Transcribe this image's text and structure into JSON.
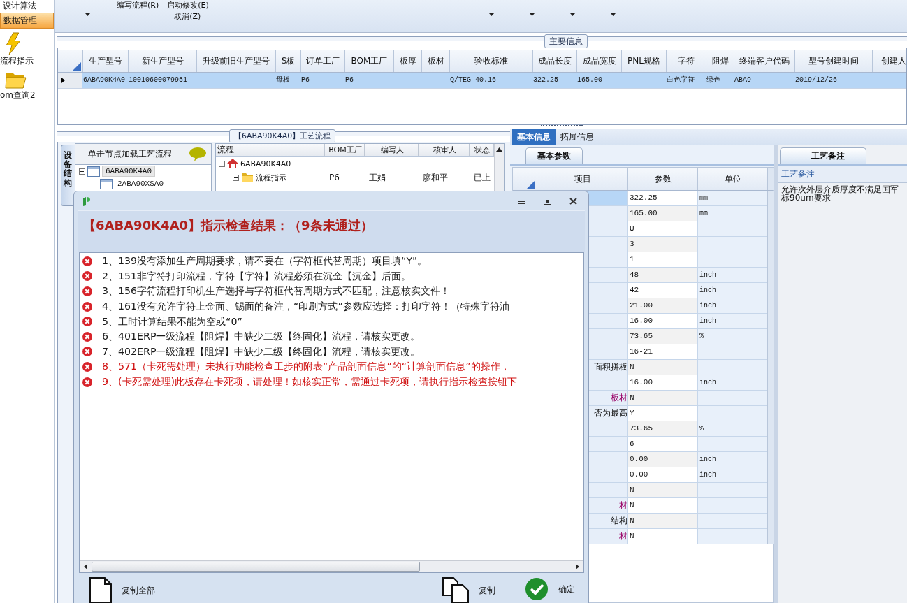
{
  "sidebar": {
    "items": [
      {
        "label": "设计算法",
        "selected": false,
        "kind": "text"
      },
      {
        "label": "数据管理",
        "selected": true,
        "kind": "text"
      },
      {
        "label": "流程指示",
        "selected": false,
        "kind": "lightning"
      },
      {
        "label": "om查询2",
        "selected": false,
        "kind": "folder"
      }
    ]
  },
  "toolbar": {
    "buttons": [
      {
        "label": "编写流程(R)"
      },
      {
        "label": "启动修改(E)"
      },
      {
        "label": "取消(Z)"
      }
    ]
  },
  "main_info": {
    "title": "主要信息",
    "columns": [
      "生产型号",
      "新生产型号",
      "升级前旧生产型号",
      "S板",
      "订单工厂",
      "BOM工厂",
      "板厚",
      "板材",
      "验收标准",
      "成品长度",
      "成品宽度",
      "PNL规格",
      "字符",
      "阻焊",
      "终端客户代码",
      "型号创建时间",
      "创建人"
    ],
    "rows": [
      {
        "selected": true,
        "cells": [
          "6ABA90K4A0",
          "10010600079951",
          null,
          "母板",
          "P6",
          "P6",
          null,
          null,
          "Q/TEG 40.16",
          "322.25",
          "165.00",
          null,
          "白色字符",
          "绿色",
          "ABA9",
          "2019/12/26",
          null
        ]
      }
    ]
  },
  "process_flow": {
    "title": "【6ABA90K4A0】工艺流程",
    "side_tab": "设备结构",
    "tree": {
      "header": "单击节点加载工艺流程",
      "nodes": [
        {
          "label": "6ABA90K4A0",
          "expanded": true,
          "selected": true,
          "children": [
            {
              "label": "2ABA90XSA0",
              "selected": false
            }
          ]
        }
      ]
    },
    "grid": {
      "columns": [
        "流程",
        "BOM工厂",
        "编写人",
        "核审人",
        "状态"
      ],
      "nodes": [
        {
          "label": "6ABA90K4A0",
          "kind": "home",
          "expanded": true,
          "children": [
            {
              "label": "流程指示",
              "kind": "folder",
              "expanded": true,
              "cells": [
                "P6",
                "王娟",
                "廖和平",
                "已上"
              ]
            }
          ]
        }
      ]
    }
  },
  "details": {
    "tabs": [
      {
        "label": "基本信息",
        "selected": true
      },
      {
        "label": "拓展信息",
        "selected": false
      }
    ],
    "param_tab": "基本参数",
    "columns": [
      "项目",
      "参数",
      "单位"
    ],
    "rows": [
      {
        "selected": true,
        "value": "322.25",
        "unit": "mm"
      },
      {
        "selected": false,
        "value": "165.00",
        "unit": "mm"
      },
      {
        "selected": false,
        "value": "U"
      },
      {
        "selected": false,
        "value": "3"
      },
      {
        "selected": false,
        "value": "1"
      },
      {
        "selected": false,
        "value": "48",
        "unit": "inch"
      },
      {
        "selected": false,
        "value": "42",
        "unit": "inch"
      },
      {
        "selected": false,
        "value": "21.00",
        "unit": "inch"
      },
      {
        "selected": false,
        "value": "16.00",
        "unit": "inch"
      },
      {
        "selected": false,
        "value": "73.65",
        "unit": "%"
      },
      {
        "selected": false,
        "value": "16-21"
      },
      {
        "selected": false,
        "item": "面积拼板",
        "value": "N"
      },
      {
        "selected": false,
        "value": "16.00",
        "unit": "inch"
      },
      {
        "selected": false,
        "item": "板材",
        "color": "#990066",
        "value": "N"
      },
      {
        "selected": false,
        "item": "否为最高",
        "value": "Y"
      },
      {
        "selected": false,
        "value": "73.65",
        "unit": "%"
      },
      {
        "selected": false,
        "value": "6"
      },
      {
        "selected": false,
        "value": "0.00",
        "unit": "inch"
      },
      {
        "selected": false,
        "value": "0.00",
        "unit": "inch"
      },
      {
        "selected": false,
        "value": "N"
      },
      {
        "selected": false,
        "item": "材",
        "color": "#990066",
        "value": "N"
      },
      {
        "selected": false,
        "item": "结构",
        "value": "N"
      },
      {
        "selected": false,
        "item": "材",
        "color": "#990066",
        "value": "N"
      }
    ],
    "notes": {
      "tab": "工艺备注",
      "header": "工艺备注",
      "text": "允许次外层介质厚度不满足国军标90um要求"
    }
  },
  "dialog": {
    "heading": "【6ABA90K4A0】指示检查结果：（9条未通过）",
    "messages": [
      {
        "text": "1、139没有添加生产周期要求，请不要在（字符框代替周期）项目填“Y”。",
        "critical": false
      },
      {
        "text": "2、151非字符打印流程，字符【字符】流程必须在沉金【沉金】后面。",
        "critical": false
      },
      {
        "text": "3、156字符流程打印机生产选择与字符框代替周期方式不匹配，注意核实文件！",
        "critical": false
      },
      {
        "text": "4、161没有允许字符上金面、锡面的备注，“印刷方式”参数应选择：打印字符！（特殊字符油",
        "critical": false
      },
      {
        "text": "5、工时计算结果不能为空或“0”",
        "critical": false
      },
      {
        "text": "6、401ERP一级流程【阻焊】中缺少二级【终固化】流程，请核实更改。",
        "critical": false
      },
      {
        "text": "7、402ERP一级流程【阻焊】中缺少二级【终固化】流程，请核实更改。",
        "critical": false
      },
      {
        "text": "8、571（卡死需处理）未执行功能检查工步的附表“产品剖面信息”的“计算剖面信息”的操作，",
        "critical": true
      },
      {
        "text": "9、(卡死需处理)此板存在卡死项，请处理！如核实正常，需通过卡死项，请执行指示检查按钮下",
        "critical": true
      }
    ],
    "buttons": [
      {
        "label": "复制全部",
        "kind": "copy-all"
      },
      {
        "label": "复制",
        "kind": "copy"
      },
      {
        "label": "确定",
        "kind": "ok"
      }
    ]
  }
}
